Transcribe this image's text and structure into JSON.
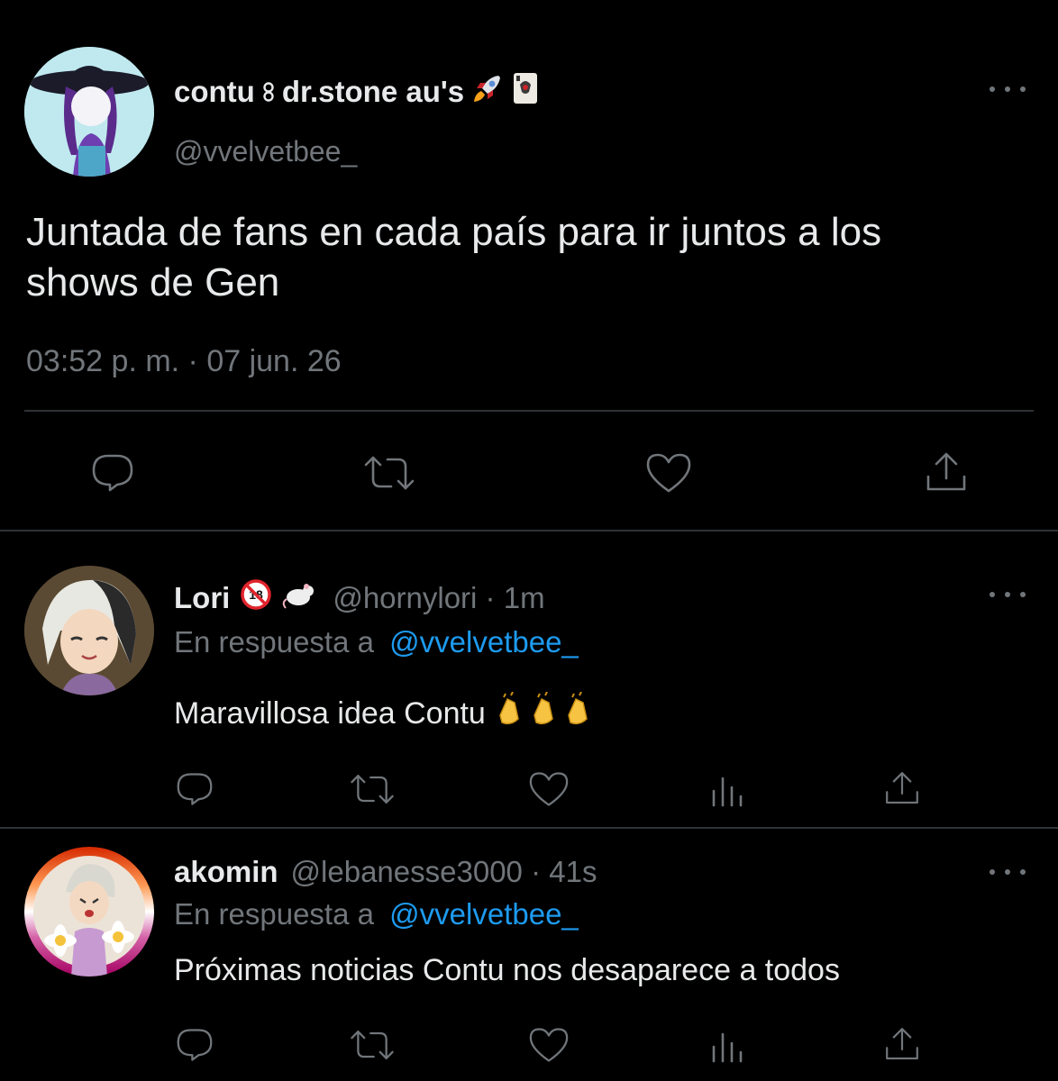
{
  "main_tweet": {
    "display_name": "contu",
    "display_name_suffix": "dr.stone au's",
    "handle": "@vvelvetbee_",
    "text_line1": "Juntada de fans en cada país para ir juntos a los",
    "text_line2": "shows de Gen",
    "timestamp": "03:52 p. m. · 07 jun. 26"
  },
  "replies": [
    {
      "display_name": "Lori",
      "handle": "@hornylori",
      "time": " · 1m",
      "reply_prefix": "En respuesta a",
      "reply_to": "@vvelvetbee_",
      "text": "Maravillosa idea Contu"
    },
    {
      "display_name": "akomin",
      "handle": "@lebanesse3000",
      "time": " · 41s",
      "reply_prefix": "En respuesta a",
      "reply_to": "@vvelvetbee_",
      "text": "Próximas noticias Contu nos desaparece a todos"
    }
  ],
  "colors": {
    "background": "#000000",
    "text": "#e7e9ea",
    "muted": "#71767b",
    "link": "#1d9bf0",
    "divider": "#2f3336"
  },
  "icons": [
    "reply-icon",
    "retweet-icon",
    "like-icon",
    "views-icon",
    "share-icon",
    "more-icon"
  ]
}
